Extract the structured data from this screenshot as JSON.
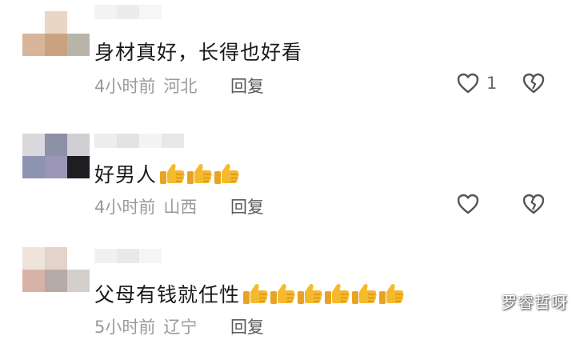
{
  "comments": [
    {
      "text": "身材真好，长得也好看",
      "time": "4小时前",
      "location": "河北",
      "reply_label": "回复",
      "like_count": "1",
      "thumbs_count": 0
    },
    {
      "text": "好男人",
      "time": "4小时前",
      "location": "山西",
      "reply_label": "回复",
      "like_count": "",
      "thumbs_count": 3
    },
    {
      "text": "父母有钱就任性",
      "time": "5小时前",
      "location": "辽宁",
      "reply_label": "回复",
      "like_count": "",
      "thumbs_count": 6
    }
  ],
  "icons": {
    "like": "heart-outline-icon",
    "dislike": "broken-heart-icon",
    "emoji": "thumbs-up-emoji"
  },
  "watermark": "罗睿哲呀",
  "colors": {
    "text": "#1a1a1a",
    "meta": "#9a9a9a",
    "icon": "#555555",
    "thumb": "#f5b92e"
  }
}
